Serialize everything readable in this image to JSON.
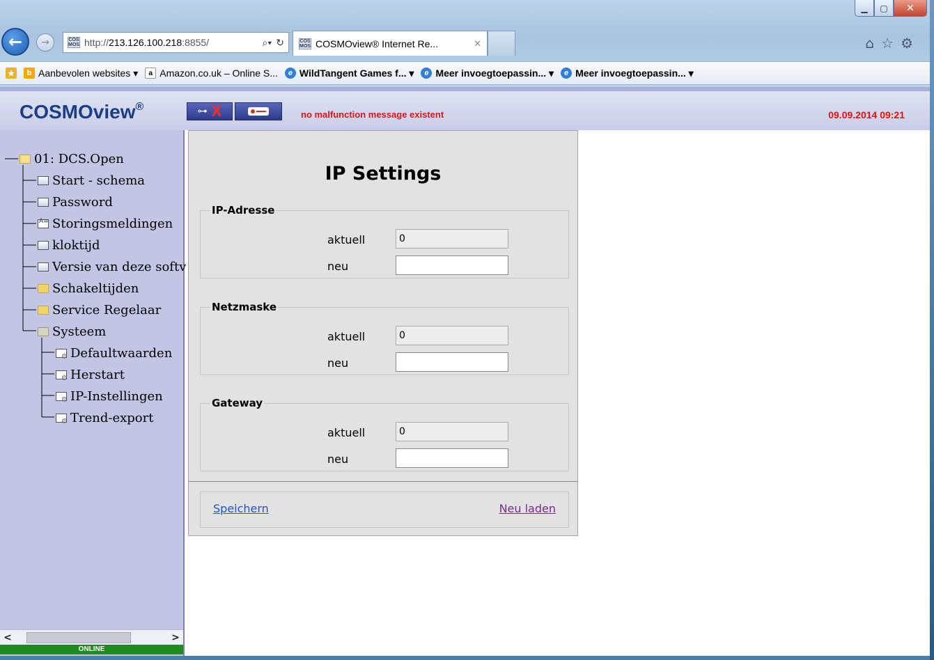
{
  "browser": {
    "address": "http://213.126.100.218:8855/",
    "address_host_bold": "213.126.100.218",
    "address_prefix": "http://",
    "address_suffix": ":8855/",
    "tab_title": "COSMOview® Internet Re...",
    "favicon_text": "COS MOS",
    "favorites": [
      {
        "label": "Aanbevolen websites ▾",
        "icon": "bing-icon"
      },
      {
        "label": "Amazon.co.uk – Online S...",
        "icon": "amazon-icon"
      },
      {
        "label": "WildTangent Games f... ▾",
        "icon": "ie-icon"
      },
      {
        "label": "Meer invoegtoepassin... ▾",
        "icon": "ie-icon"
      },
      {
        "label": "Meer invoegtoepassin... ▾",
        "icon": "ie-icon"
      }
    ]
  },
  "header": {
    "logo": "COSMOview",
    "logo_mark": "®",
    "message": "no malfunction message existent",
    "datetime": "09.09.2014 09:21"
  },
  "tree": {
    "root": "01: DCS.Open",
    "items": [
      {
        "label": "Start - schema",
        "icon": "screen"
      },
      {
        "label": "Password",
        "icon": "screen"
      },
      {
        "label": "Storingsmeldingen",
        "icon": "doc"
      },
      {
        "label": "kloktijd",
        "icon": "screen"
      },
      {
        "label": "Versie van deze softv",
        "icon": "screen"
      },
      {
        "label": "Schakeltijden",
        "icon": "folder"
      },
      {
        "label": "Service Regelaar",
        "icon": "folder"
      },
      {
        "label": "Systeem",
        "icon": "folder-sys"
      }
    ],
    "systeem_children": [
      {
        "label": "Defaultwaarden"
      },
      {
        "label": "Herstart"
      },
      {
        "label": "IP-Instellingen"
      },
      {
        "label": "Trend-export"
      }
    ],
    "status": "ONLINE"
  },
  "panel": {
    "title": "IP Settings",
    "groups": [
      {
        "legend": "IP-Adresse",
        "current_label": "aktuell",
        "current_value": "0",
        "new_label": "neu",
        "new_value": ""
      },
      {
        "legend": "Netzmaske",
        "current_label": "aktuell",
        "current_value": "0",
        "new_label": "neu",
        "new_value": ""
      },
      {
        "legend": "Gateway",
        "current_label": "aktuell",
        "current_value": "0",
        "new_label": "neu",
        "new_value": ""
      }
    ],
    "save_label": "Speichern",
    "reload_label": "Neu laden"
  },
  "colors": {
    "alarm_red": "#e11212",
    "sidebar_bg": "#c2c5e3",
    "logo_blue": "#1c3e86",
    "online_green": "#1f8a1f"
  }
}
